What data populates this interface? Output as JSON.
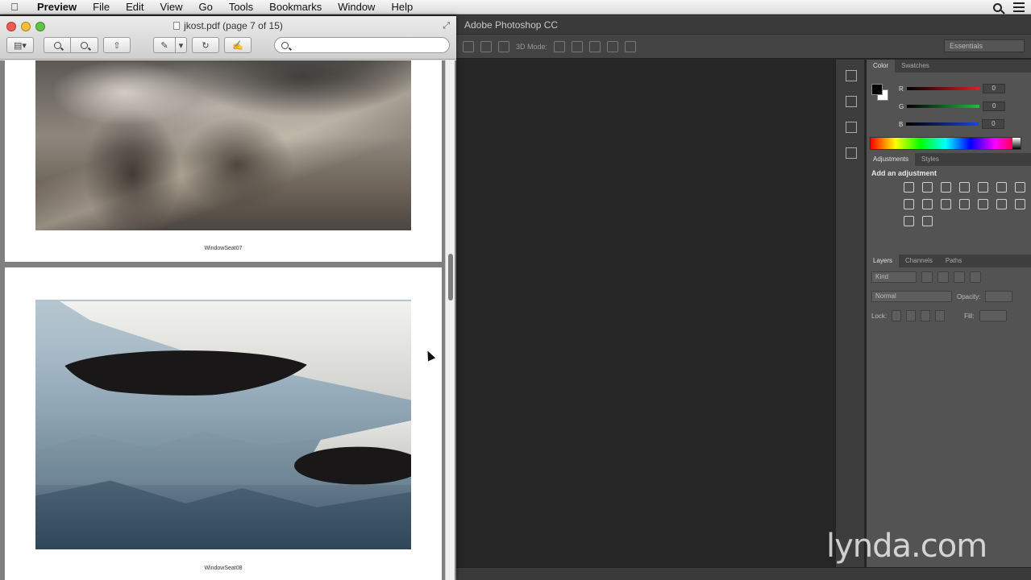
{
  "menubar": {
    "app": "Preview",
    "items": [
      "File",
      "Edit",
      "View",
      "Go",
      "Tools",
      "Bookmarks",
      "Window",
      "Help"
    ]
  },
  "preview": {
    "title": "jkost.pdf (page 7 of 15)",
    "search": {
      "placeholder": "",
      "value": ""
    },
    "pages": [
      {
        "caption": "WindowSeat07"
      },
      {
        "caption": "WindowSeat08"
      }
    ]
  },
  "photoshop": {
    "title": "Adobe Photoshop CC",
    "options_mode": "3D Mode:",
    "workspace": "Essentials",
    "color_panel": {
      "tabs": [
        "Color",
        "Swatches"
      ],
      "channels": [
        {
          "label": "R",
          "value": "0",
          "color": "#c02020"
        },
        {
          "label": "G",
          "value": "0",
          "color": "#20a030"
        },
        {
          "label": "B",
          "value": "0",
          "color": "#2030c0"
        }
      ]
    },
    "adjustments_panel": {
      "tabs": [
        "Adjustments",
        "Styles"
      ],
      "heading": "Add an adjustment"
    },
    "layers_panel": {
      "tabs": [
        "Layers",
        "Channels",
        "Paths"
      ],
      "kind": "Kind",
      "blend_mode": "Normal",
      "opacity_label": "Opacity:",
      "lock_label": "Lock:",
      "fill_label": "Fill:"
    }
  },
  "watermark": "lynda.com"
}
